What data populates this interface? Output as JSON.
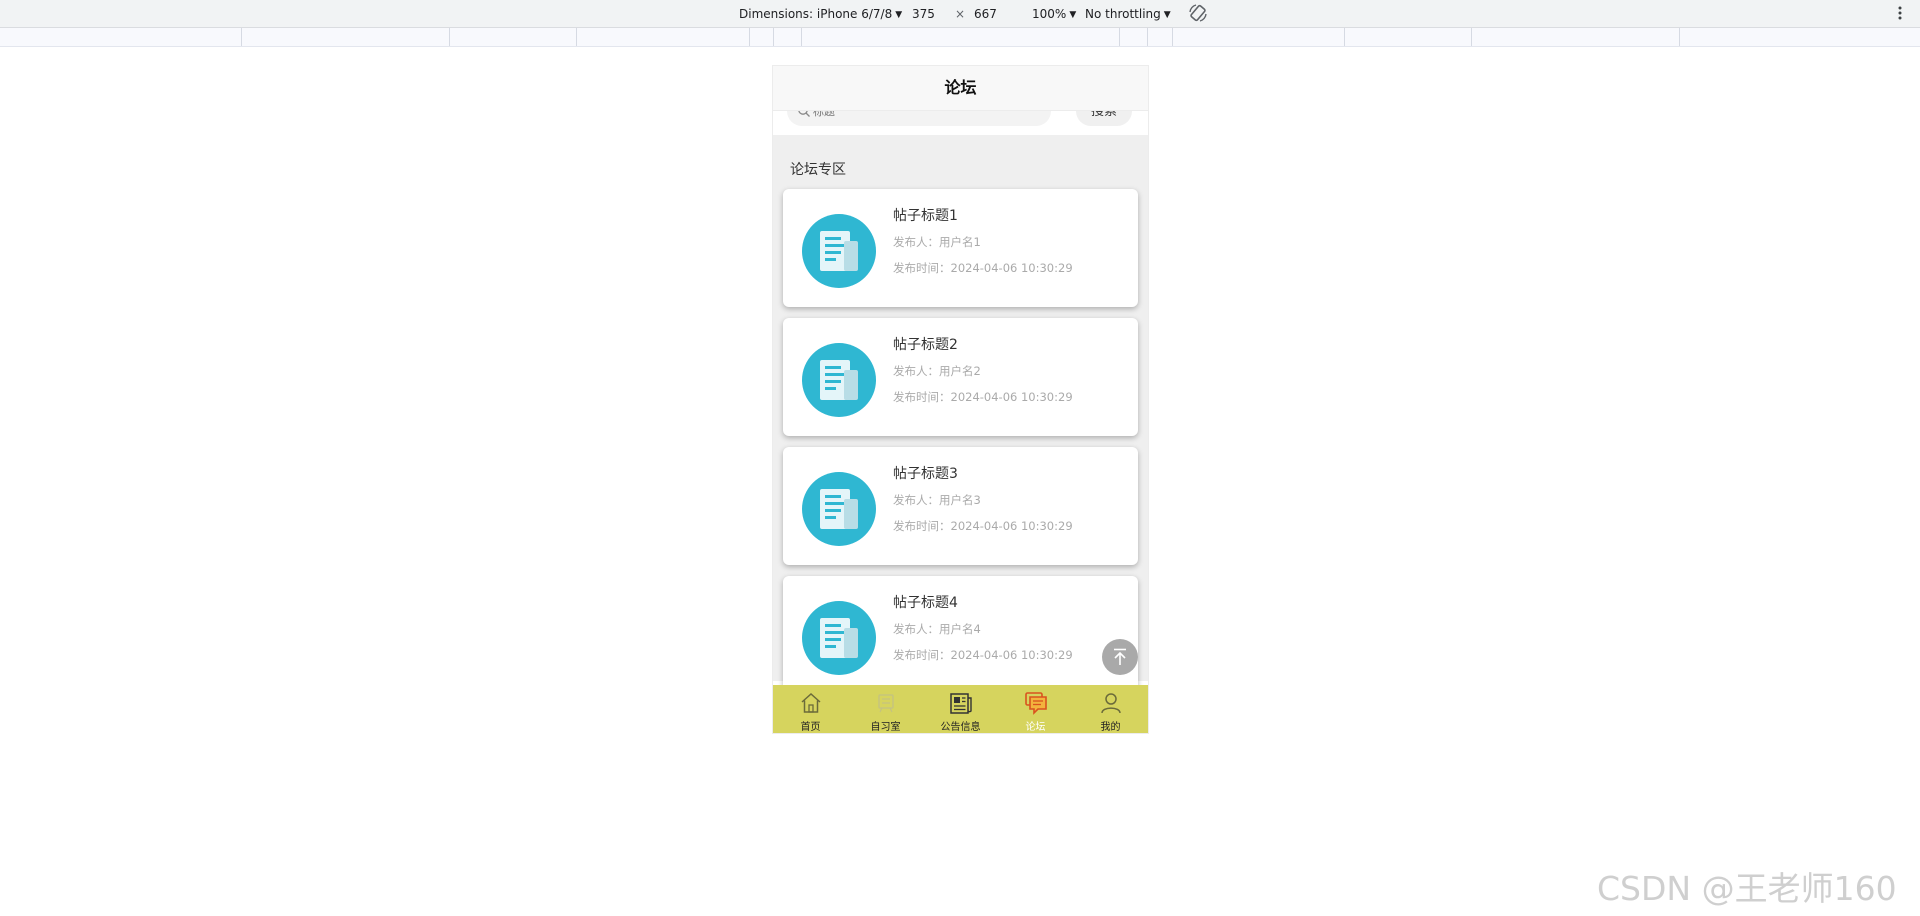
{
  "devtools": {
    "dimensions_label": "Dimensions: iPhone 6/7/8",
    "width": "375",
    "times": "×",
    "height": "667",
    "zoom": "100%",
    "throttling": "No throttling",
    "icons": [
      "rotate-icon",
      "kebab-menu-icon"
    ]
  },
  "app": {
    "nav_title": "论坛",
    "search": {
      "placeholder": "标题",
      "button_label": "搜索"
    },
    "section_title": "论坛专区",
    "posts": [
      {
        "title": "帖子标题1",
        "author": "发布人：用户名1",
        "time": "发布时间：2024-04-06 10:30:29"
      },
      {
        "title": "帖子标题2",
        "author": "发布人：用户名2",
        "time": "发布时间：2024-04-06 10:30:29"
      },
      {
        "title": "帖子标题3",
        "author": "发布人：用户名3",
        "time": "发布时间：2024-04-06 10:30:29"
      },
      {
        "title": "帖子标题4",
        "author": "发布人：用户名4",
        "time": "发布时间：2024-04-06 10:30:29"
      }
    ],
    "tabs": [
      {
        "label": "首页",
        "icon": "home-icon",
        "active": false
      },
      {
        "label": "自习室",
        "icon": "study-room-icon",
        "active": false
      },
      {
        "label": "公告信息",
        "icon": "newspaper-icon",
        "active": false
      },
      {
        "label": "论坛",
        "icon": "chat-icon",
        "active": true
      },
      {
        "label": "我的",
        "icon": "user-icon",
        "active": false
      }
    ],
    "colors": {
      "tab_bar": "#d6d45e",
      "thumb_circle": "#2fb7d2",
      "active_tab_icon": "#d9531e"
    }
  },
  "watermark": "CSDN @王老师160"
}
